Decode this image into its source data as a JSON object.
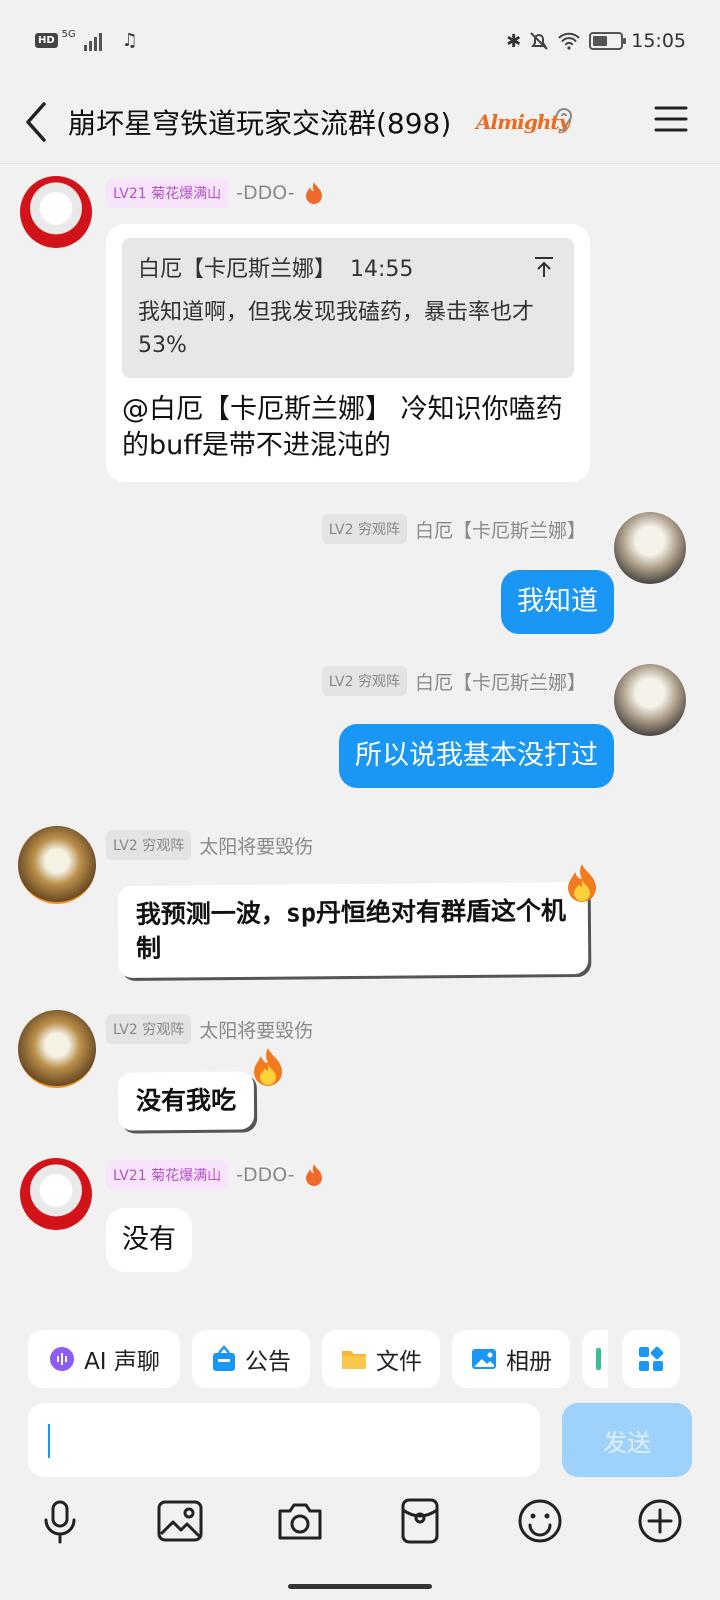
{
  "status_bar": {
    "hd": "HD",
    "network": "5G",
    "time": "15:05"
  },
  "header": {
    "title": "崩坏星穹铁道玩家交流群(898)",
    "badge_text": "Almighty"
  },
  "messages": [
    {
      "level": "LV21 菊花爆满山",
      "name": "-DDO-",
      "quote": {
        "author": "白厄【卡厄斯兰娜】",
        "time": "14:55",
        "text": "我知道啊，但我发现我磕药，暴击率也才53%"
      },
      "text": "@白厄【卡厄斯兰娜】 冷知识你嗑药的buff是带不进混沌的"
    },
    {
      "level": "LV2 穷观阵",
      "name": "白厄【卡厄斯兰娜】",
      "text": "我知道"
    },
    {
      "level": "LV2 穷观阵",
      "name": "白厄【卡厄斯兰娜】",
      "text": "所以说我基本没打过"
    },
    {
      "level": "LV2 穷观阵",
      "name": "太阳将要毁伤",
      "text": "我预测一波，sp丹恒绝对有群盾这个机制"
    },
    {
      "level": "LV2 穷观阵",
      "name": "太阳将要毁伤",
      "text": "没有我吃"
    },
    {
      "level": "LV21 菊花爆满山",
      "name": "-DDO-",
      "text": "没有"
    }
  ],
  "quick_actions": [
    {
      "label": "AI 声聊",
      "icon": "ai-voice-icon"
    },
    {
      "label": "公告",
      "icon": "announcement-icon"
    },
    {
      "label": "文件",
      "icon": "folder-icon"
    },
    {
      "label": "相册",
      "icon": "album-icon"
    }
  ],
  "input": {
    "value": "",
    "send_label": "发送"
  },
  "toolbar": [
    "microphone-icon",
    "image-icon",
    "camera-icon",
    "red-packet-icon",
    "emoji-icon",
    "plus-icon"
  ],
  "colors": {
    "accent": "#1a96f5",
    "background": "#f1f1f2",
    "send_disabled": "#9fd2fa"
  }
}
